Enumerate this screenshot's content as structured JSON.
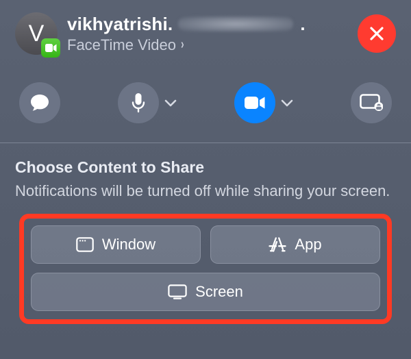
{
  "header": {
    "avatar_letter": "V",
    "contact_name_prefix": "vikhyatrishi.",
    "contact_name_dot": ".",
    "call_type": "FaceTime Video",
    "caret": "›"
  },
  "controls": {
    "messages_icon": "message-icon",
    "mic_icon": "microphone-icon",
    "camera_icon": "camera-icon",
    "share_icon": "share-screen-icon"
  },
  "panel": {
    "title": "Choose Content to Share",
    "subtitle": "Notifications will be turned off while sharing your screen."
  },
  "share": {
    "window_label": "Window",
    "app_label": "App",
    "screen_label": "Screen"
  }
}
